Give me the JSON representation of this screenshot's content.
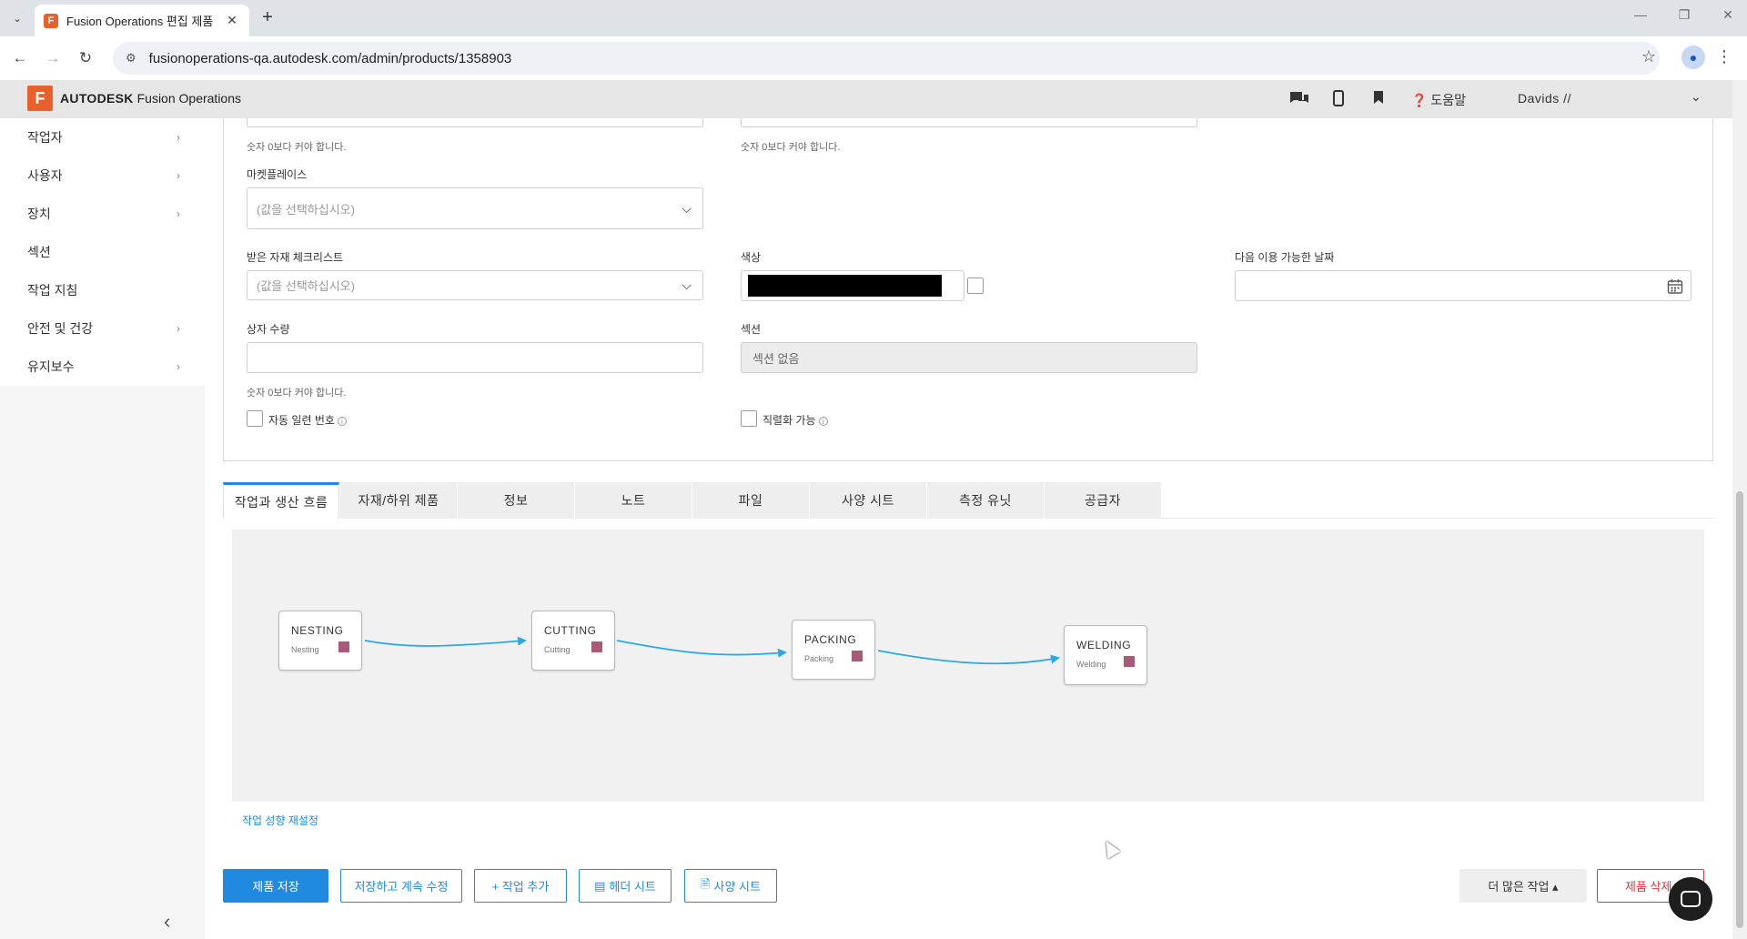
{
  "browser": {
    "tab_title": "Fusion Operations 편집 제품",
    "url": "fusionoperations-qa.autodesk.com/admin/products/1358903"
  },
  "app_header": {
    "logo_letter": "F",
    "brand_bold": "AUTODESK",
    "brand_rest": "Fusion Operations",
    "help_label": "도움말",
    "user_label": "Davids //"
  },
  "sidebar": {
    "items": [
      {
        "label": "작업자",
        "has_chevron": true
      },
      {
        "label": "사용자",
        "has_chevron": true
      },
      {
        "label": "장치",
        "has_chevron": true
      },
      {
        "label": "섹션",
        "has_chevron": false
      },
      {
        "label": "작업 지침",
        "has_chevron": false
      },
      {
        "label": "안전 및 건강",
        "has_chevron": true
      },
      {
        "label": "유지보수",
        "has_chevron": true
      }
    ]
  },
  "form": {
    "hint_positive": "숫자 0보다 커야 합니다.",
    "marketplace": {
      "label": "마켓플레이스",
      "placeholder": "(값을 선택하십시오)"
    },
    "checklist": {
      "label": "받은 자재 체크리스트",
      "placeholder": "(값을 선택하십시오)"
    },
    "color": {
      "label": "색상",
      "value": "#000000"
    },
    "next_available_date": {
      "label": "다음 이용 가능한 날짜",
      "value": ""
    },
    "box_quantity": {
      "label": "상자 수량",
      "value": ""
    },
    "section": {
      "label": "섹션",
      "value": "섹션 없음"
    },
    "auto_serial": {
      "label": "자동 일련 번호",
      "checked": false
    },
    "serializable": {
      "label": "직렬화 가능",
      "checked": false
    }
  },
  "tabs": [
    {
      "label": "작업과 생산 흐름",
      "active": true
    },
    {
      "label": "자재/하위 제품",
      "active": false
    },
    {
      "label": "정보",
      "active": false
    },
    {
      "label": "노트",
      "active": false
    },
    {
      "label": "파일",
      "active": false
    },
    {
      "label": "사양 시트",
      "active": false
    },
    {
      "label": "측정 유닛",
      "active": false
    },
    {
      "label": "공급자",
      "active": false
    }
  ],
  "flow": {
    "nodes": [
      {
        "title": "NESTING",
        "subtitle": "Nesting"
      },
      {
        "title": "CUTTING",
        "subtitle": "Cutting"
      },
      {
        "title": "PACKING",
        "subtitle": "Packing"
      },
      {
        "title": "WELDING",
        "subtitle": "Welding"
      }
    ],
    "node_color": "#a85a78",
    "edge_color": "#29abe2",
    "reset_label": "작업 성향 재설정"
  },
  "actions": {
    "save": "제품 저장",
    "save_continue": "저장하고 계속 수정",
    "add_task": "+ 작업 추가",
    "header_sheet": "헤더 시트",
    "spec_sheet": "사양 시트",
    "more_actions": "더 많은 작업 ▴",
    "delete": "제품 삭제"
  },
  "colors": {
    "accent": "#1f8ae0",
    "brand": "#e8612d",
    "danger": "#d9363e"
  }
}
